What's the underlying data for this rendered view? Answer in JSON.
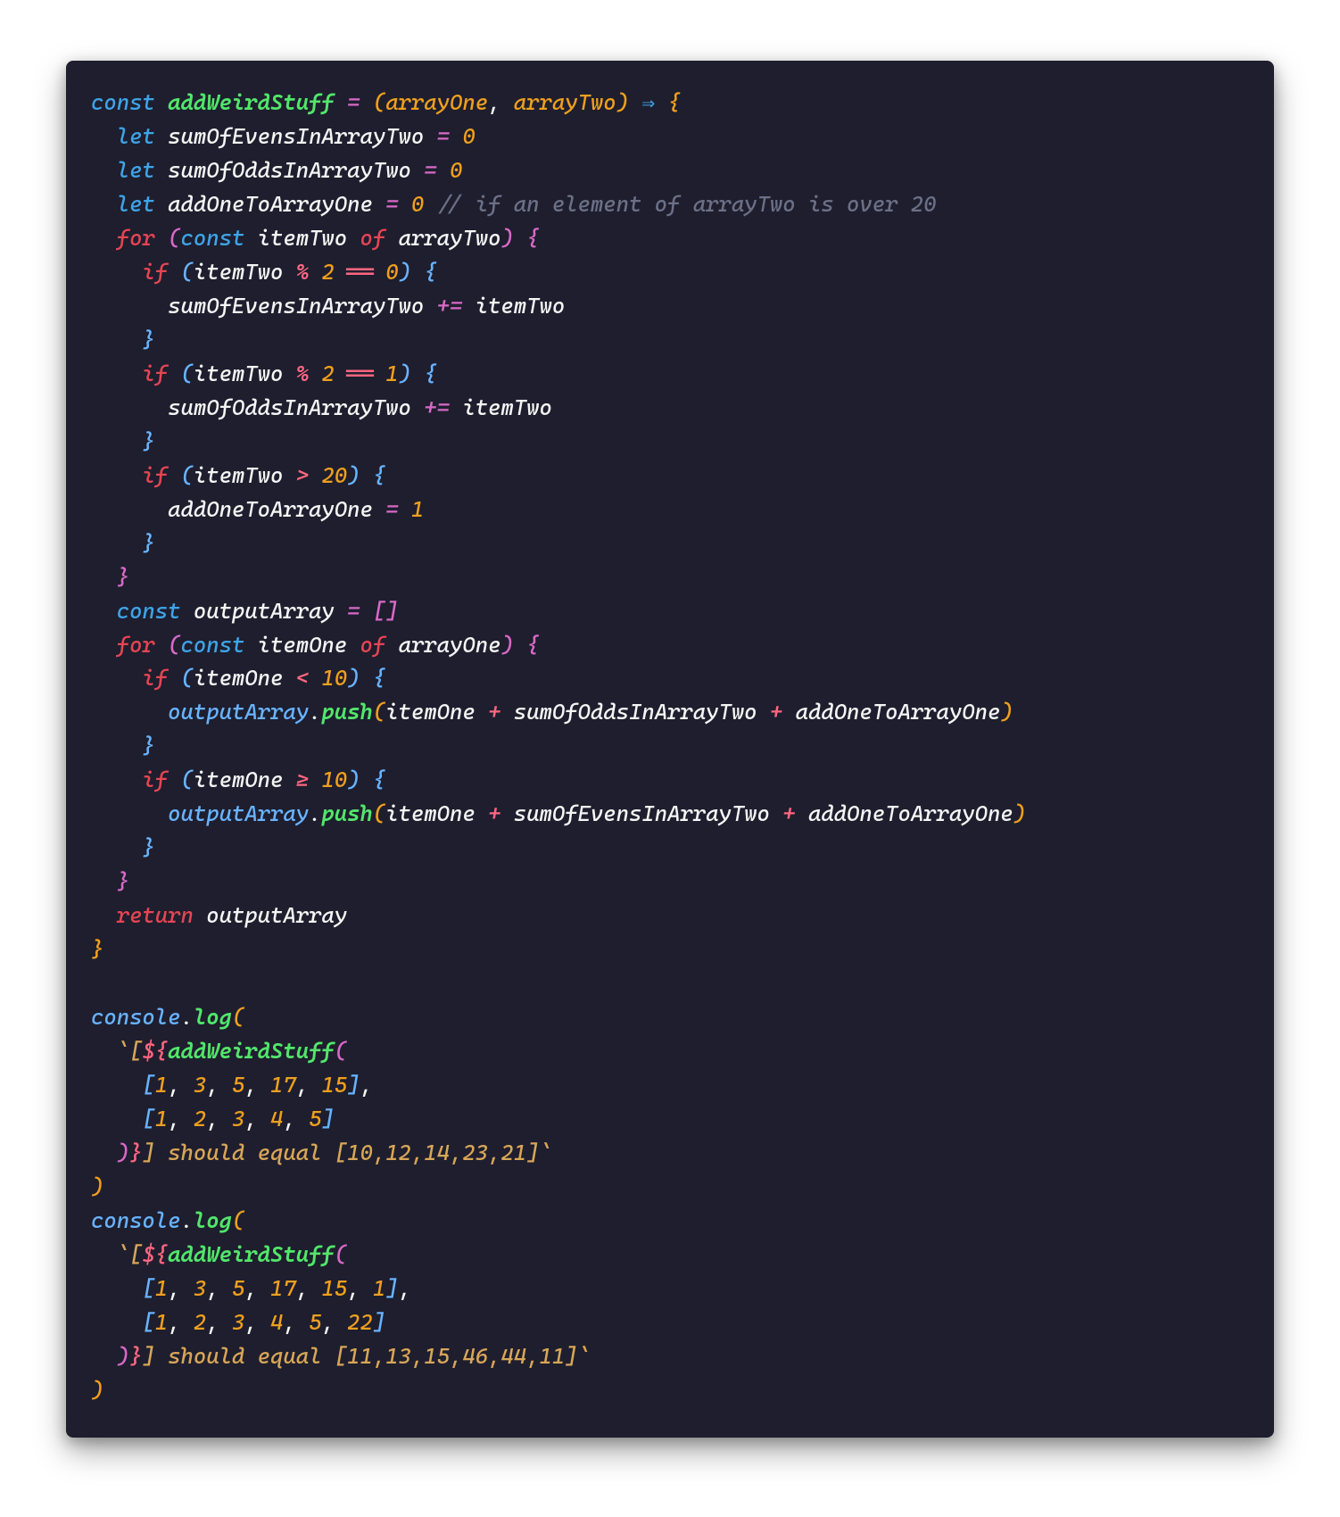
{
  "colors": {
    "background": "#1e1e2e",
    "text": "#f5f5f5",
    "keyword_decl": "#3ea4e8",
    "keyword_ctrl": "#e64553",
    "function": "#52e66a",
    "parameter": "#ef9f1d",
    "operator": "#ff6680",
    "assign": "#d869c7",
    "comment": "#6c7086",
    "number": "#ef9f1d",
    "string": "#d8a657",
    "bracket_level1": "#ef9f1d",
    "bracket_level2": "#d869c7",
    "bracket_level3": "#68b3ff"
  },
  "code": {
    "function_name": "addWeirdStuff",
    "params": {
      "one": "arrayOne",
      "two": "arrayTwo"
    },
    "vars": {
      "sumEvens": "sumOfEvensInArrayTwo",
      "sumOdds": "sumOfOddsInArrayTwo",
      "addOne": "addOneToArrayOne",
      "itemTwo": "itemTwo",
      "itemOne": "itemOne",
      "output": "outputArray"
    },
    "comment_line4": "// if an element of arrayTwo is over 20",
    "literals": {
      "zero": "0",
      "one": "1",
      "two": "2",
      "ten": "10",
      "twenty": "20"
    },
    "tests": {
      "call1_arg1": "[1, 3, 5, 17, 15]",
      "call1_arg2": "[1, 2, 3, 4, 5]",
      "call1_expect": " should equal [10,12,14,23,21]",
      "call2_arg1": "[1, 3, 5, 17, 15, 1]",
      "call2_arg2": "[1, 2, 3, 4, 5, 22]",
      "call2_expect": " should equal [11,13,15,46,44,11]"
    },
    "console": "console",
    "log": "log",
    "push": "push",
    "kw": {
      "const": "const",
      "let": "let",
      "for": "for",
      "of": "of",
      "if": "if",
      "return": "return"
    },
    "call1_nums": {
      "a": [
        "1",
        "3",
        "5",
        "17",
        "15"
      ],
      "b": [
        "1",
        "2",
        "3",
        "4",
        "5"
      ]
    },
    "call2_nums": {
      "a": [
        "1",
        "3",
        "5",
        "17",
        "15",
        "1"
      ],
      "b": [
        "1",
        "2",
        "3",
        "4",
        "5",
        "22"
      ]
    }
  }
}
